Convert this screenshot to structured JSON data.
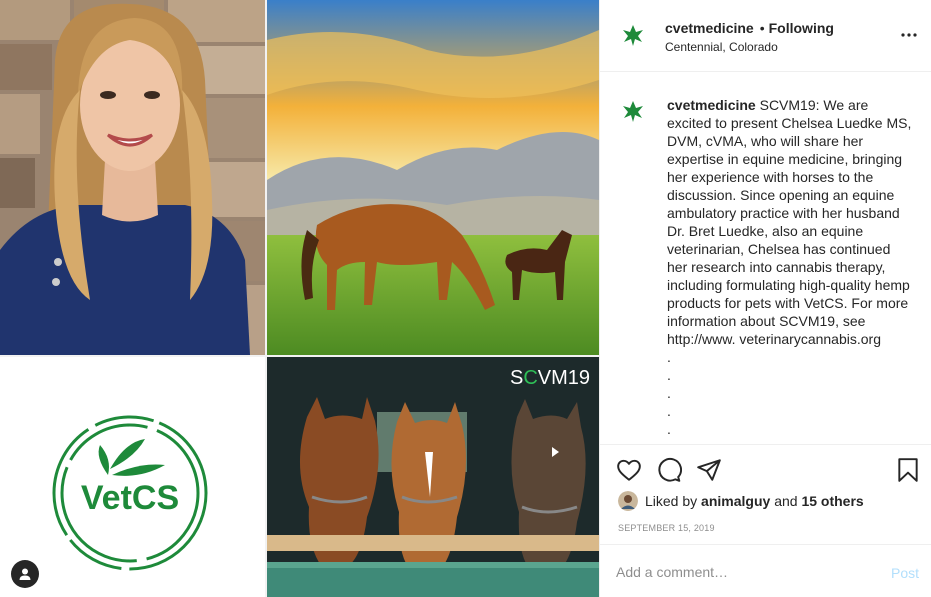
{
  "post": {
    "username": "cvetmedicine",
    "separator": "•",
    "follow_status": "Following",
    "location": "Centennial, Colorado",
    "caption_text": "SCVM19: We are excited to present Chelsea Luedke MS, DVM, cVMA, who will share her expertise in equine medicine, bringing her experience with horses to the discussion. Since opening an equine ambulatory practice with her husband Dr. Bret Luedke, also an equine veterinarian, Chelsea has continued her research into cannabis therapy, including formulating high-quality hemp products for pets with VetCS. For more information about SCVM19, see http://www. veterinarycannabis.org",
    "caption_dots": [
      ".",
      ".",
      ".",
      ".",
      "."
    ],
    "liked_by_prefix": "Liked by",
    "liked_by_user": "animalguy",
    "liked_by_and": "and",
    "liked_by_others": "15 others",
    "date": "SEPTEMBER 15, 2019"
  },
  "media": {
    "overlay_prefix": "S",
    "overlay_accent": "C",
    "overlay_suffix": "VM19",
    "logo_text": "VetCS",
    "brand_green": "#1e8a3a"
  },
  "comment_box": {
    "placeholder": "Add a comment…",
    "post_label": "Post"
  },
  "icons": {
    "more": "more-options-icon",
    "like": "heart-icon",
    "comment": "comment-bubble-icon",
    "share": "paper-plane-icon",
    "save": "bookmark-icon",
    "tag": "user-tag-icon"
  }
}
